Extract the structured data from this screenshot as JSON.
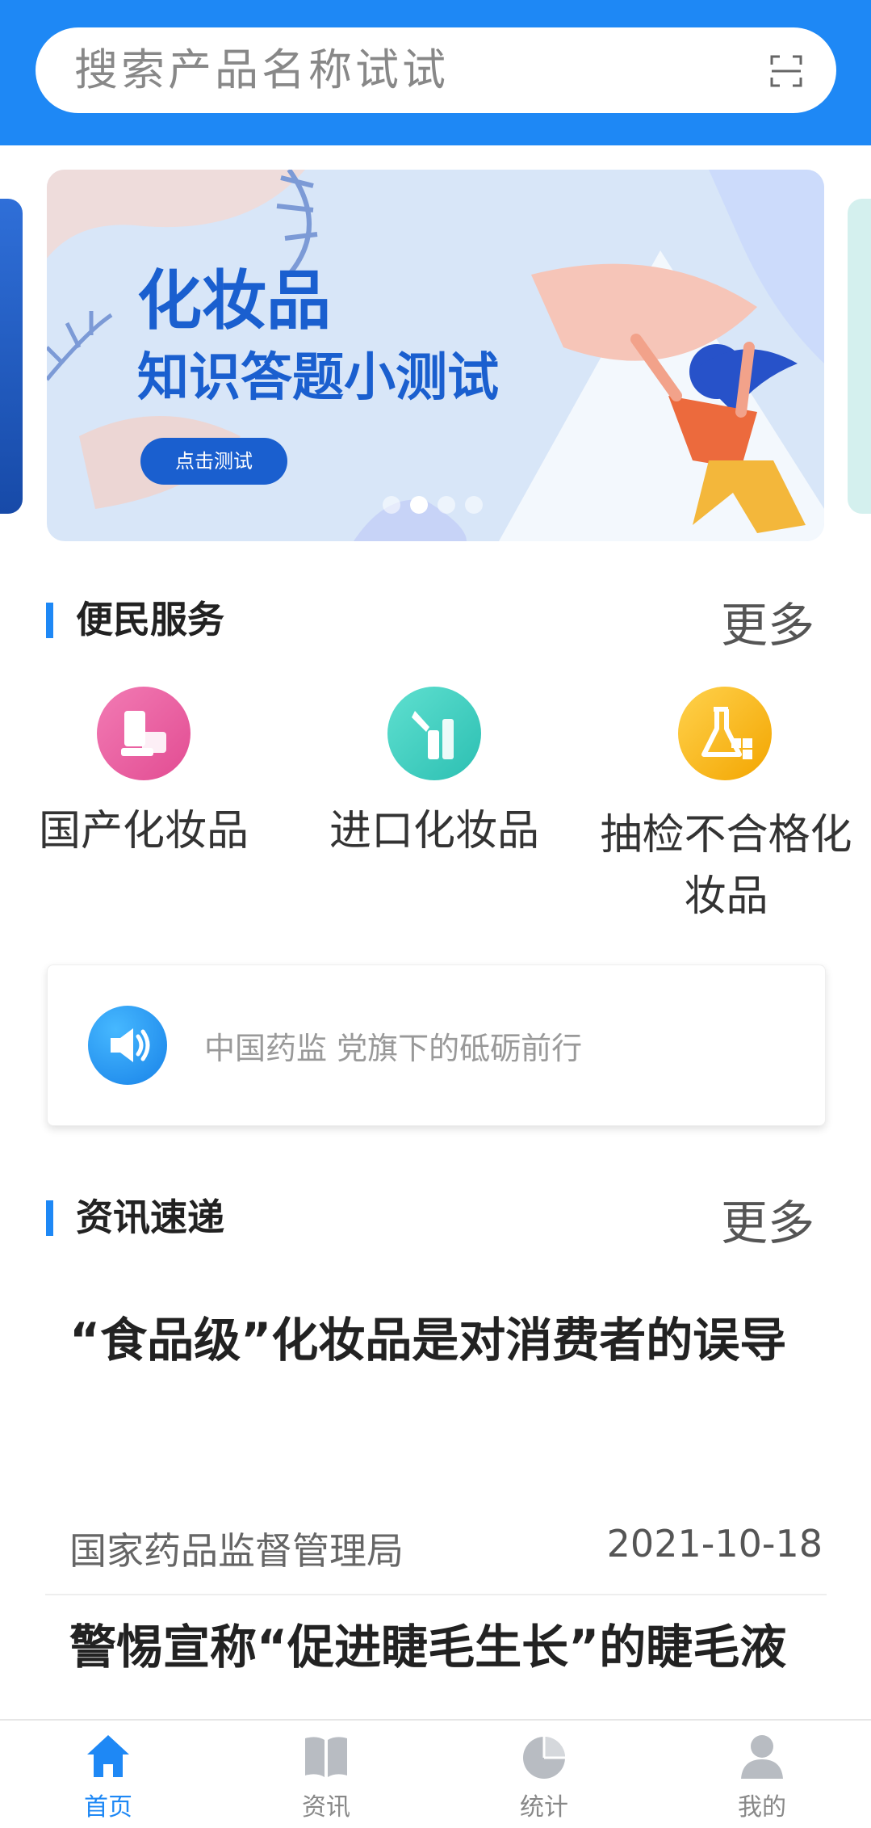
{
  "search": {
    "placeholder": "搜索产品名称试试"
  },
  "banner": {
    "title_line1": "化妆品",
    "title_line2": "知识答题小测试",
    "button_label": "点击测试",
    "dots_total": 4,
    "dots_active": 2
  },
  "services": {
    "title": "便民服务",
    "more_label": "更多",
    "items": [
      {
        "label": "国产化妆品",
        "icon": "domestic-cosmetics-icon",
        "color": "#ec5aa0"
      },
      {
        "label": "进口化妆品",
        "icon": "imported-cosmetics-icon",
        "color": "#3ccfc0"
      },
      {
        "label": "抽检不合格化妆品",
        "icon": "failed-inspection-icon",
        "color": "#f4b400"
      }
    ]
  },
  "notice": {
    "text": "中国药监 党旗下的砥砺前行",
    "icon": "speaker-icon"
  },
  "news": {
    "title": "资讯速递",
    "more_label": "更多",
    "items": [
      {
        "title": "“食品级”化妆品是对消费者的误导",
        "source": "国家药品监督管理局",
        "date": "2021-10-18"
      },
      {
        "title": "警惕宣称“促进睫毛生长”的睫毛液"
      }
    ]
  },
  "tabbar": {
    "tabs": [
      {
        "label": "首页",
        "icon": "home-icon",
        "active": true
      },
      {
        "label": "资讯",
        "icon": "book-icon",
        "active": false
      },
      {
        "label": "统计",
        "icon": "pie-chart-icon",
        "active": false
      },
      {
        "label": "我的",
        "icon": "user-icon",
        "active": false
      }
    ]
  },
  "colors": {
    "accent": "#1e88f5",
    "banner_bg": "#d8e6f8",
    "banner_text": "#1a5fcf"
  }
}
